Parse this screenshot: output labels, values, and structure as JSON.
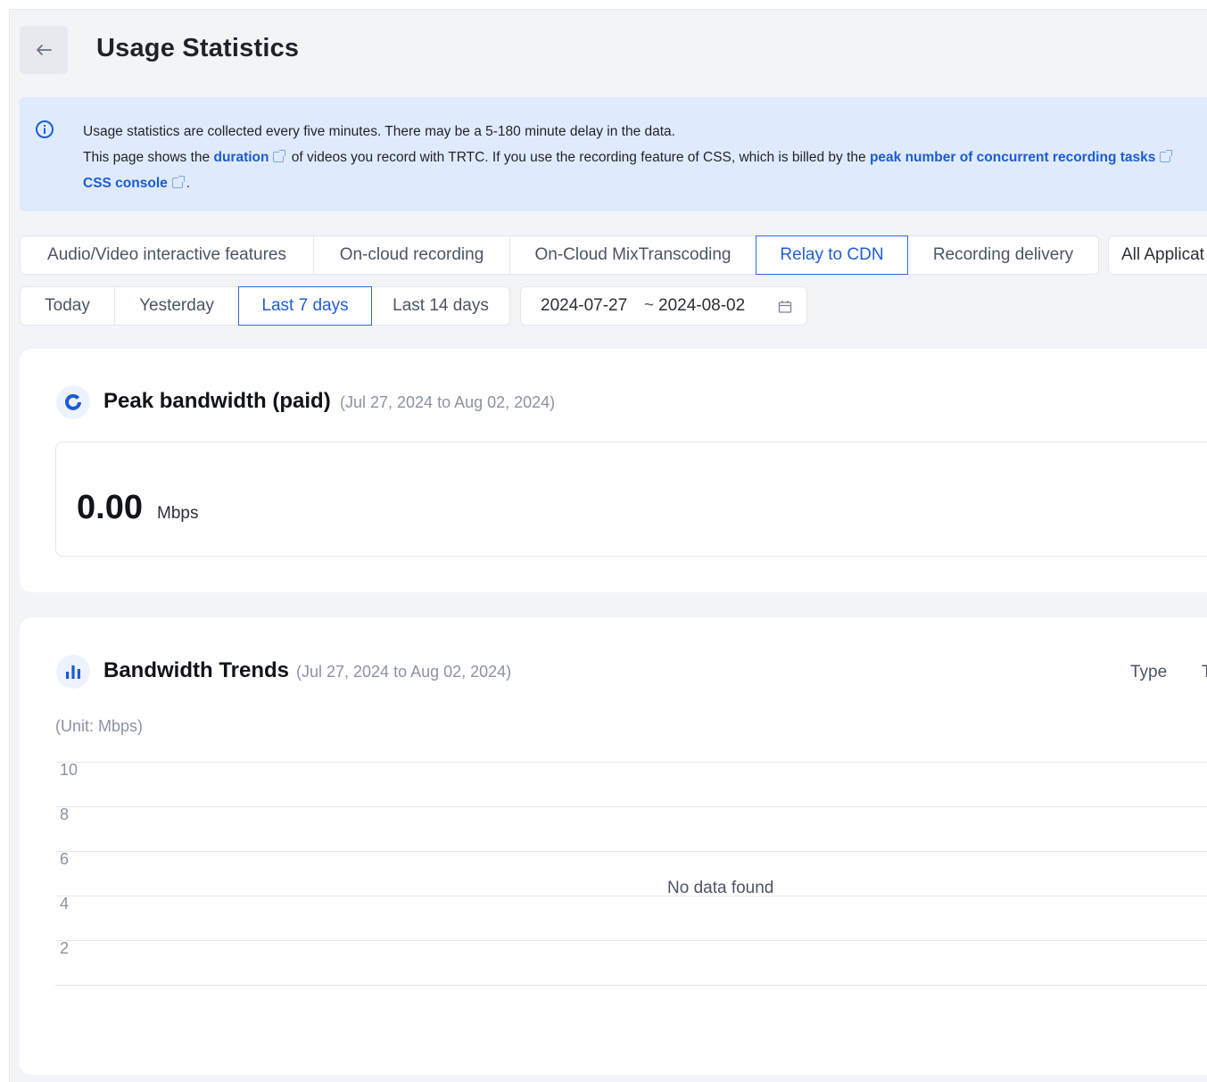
{
  "header": {
    "title": "Usage Statistics"
  },
  "notice": {
    "line1": "Usage statistics are collected every five minutes. There may be a 5-180 minute delay in the data.",
    "line2_a": "This page shows the ",
    "line2_link1": "duration",
    "line2_b": " of videos you record with TRTC. If you use the recording feature of CSS, which is billed by the ",
    "line2_link2": "peak number of concurrent recording tasks",
    "line3_link": "CSS console",
    "line3_end": "."
  },
  "tabs": [
    {
      "label": "Audio/Video interactive features"
    },
    {
      "label": "On-cloud recording"
    },
    {
      "label": "On-Cloud MixTranscoding"
    },
    {
      "label": "Relay to CDN"
    },
    {
      "label": "Recording delivery"
    }
  ],
  "active_tab": "Relay to CDN",
  "app_select": {
    "value": "All Applicat"
  },
  "date_tabs": [
    {
      "label": "Today"
    },
    {
      "label": "Yesterday"
    },
    {
      "label": "Last 7 days"
    },
    {
      "label": "Last 14 days"
    }
  ],
  "active_date_tab": "Last 7 days",
  "date_range": {
    "start": "2024-07-27",
    "separator": "~",
    "end": "2024-08-02"
  },
  "peak": {
    "title": "Peak bandwidth (paid)",
    "range": "(Jul 27, 2024 to Aug 02, 2024)",
    "value": "0.00",
    "unit": "Mbps"
  },
  "trends": {
    "title": "Bandwidth Trends",
    "range": "(Jul 27, 2024 to Aug 02, 2024)",
    "type_label": "Type",
    "type_value": "T",
    "unit_label": "(Unit: Mbps)",
    "empty_text": "No data found"
  },
  "chart_data": {
    "type": "line",
    "title": "Bandwidth Trends",
    "ylabel": "(Unit: Mbps)",
    "y_ticks": [
      "10",
      "8",
      "6",
      "4",
      "2"
    ],
    "ylim": [
      0,
      10
    ],
    "series": [],
    "grid": true
  },
  "colors": {
    "accent": "#1f5fd1",
    "page_bg": "#f3f4f7",
    "notice_bg": "#dfebfd"
  }
}
